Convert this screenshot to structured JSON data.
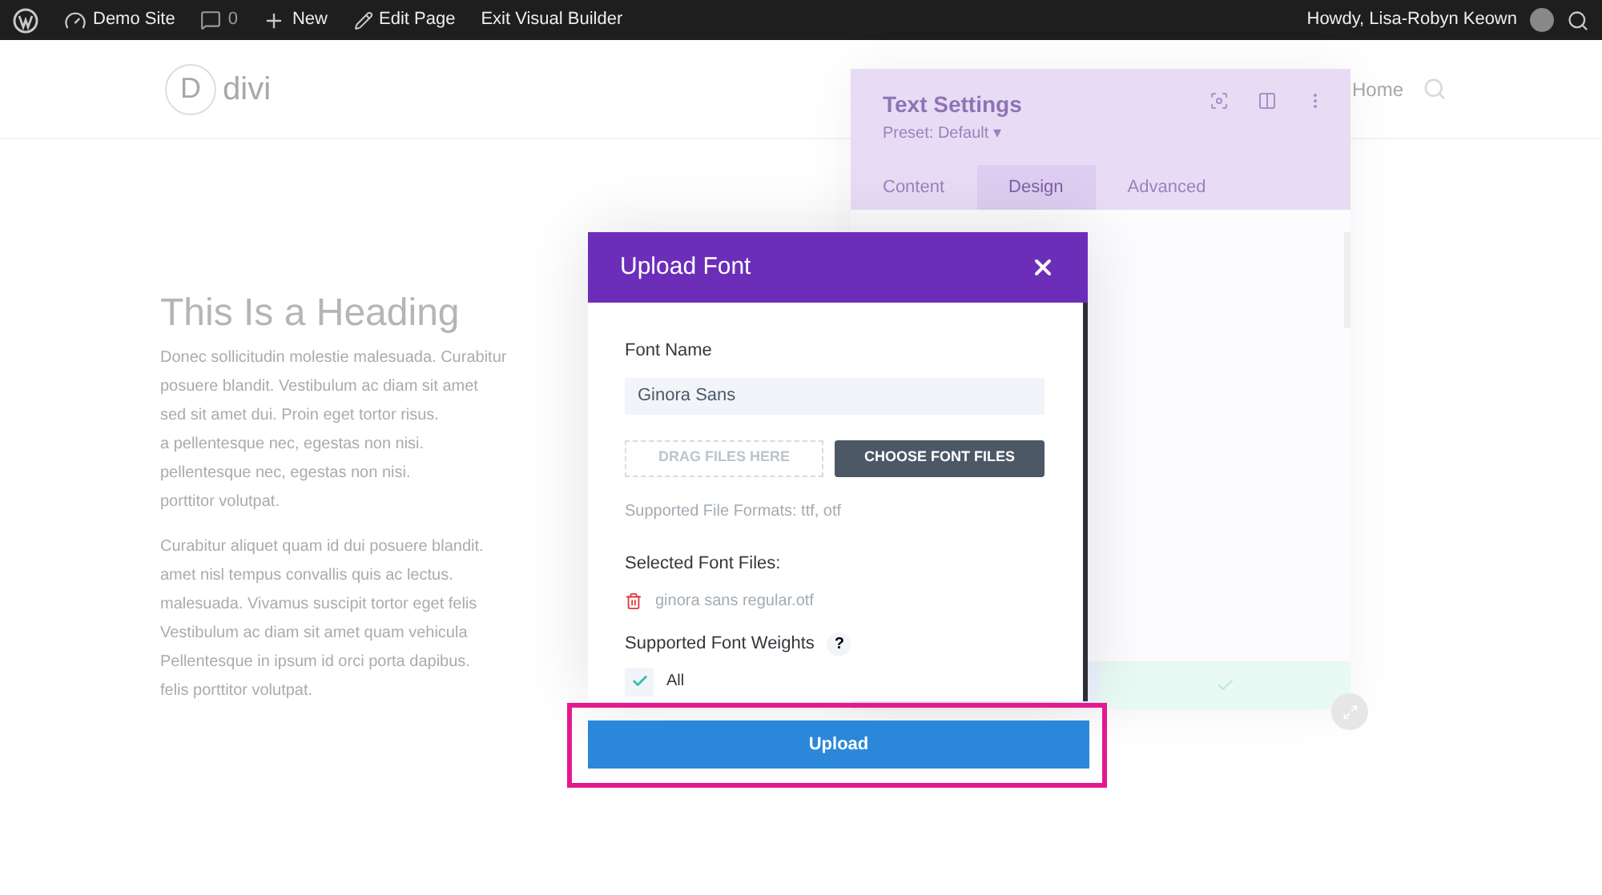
{
  "admin_bar": {
    "site": "Demo Site",
    "comments": "0",
    "new": "New",
    "edit": "Edit Page",
    "exit": "Exit Visual Builder",
    "greeting": "Howdy, Lisa-Robyn Keown"
  },
  "site_header": {
    "logo_letter": "D",
    "logo_text": "divi",
    "nav": "Home"
  },
  "page": {
    "heading": "This Is a Heading",
    "paragraphs": [
      [
        "Donec sollicitudin molestie malesuada. Curabitur",
        "posuere blandit. Vestibulum ac diam sit amet",
        "sed sit amet dui. Proin eget tortor risus.",
        "a pellentesque nec, egestas non nisi.",
        "pellentesque nec, egestas non nisi.",
        "porttitor volutpat."
      ],
      [
        "Curabitur aliquet quam id dui posuere blandit.",
        "amet nisl tempus convallis quis ac lectus.",
        "malesuada. Vivamus suscipit tortor eget felis",
        "Vestibulum ac diam sit amet quam vehicula",
        "Pellentesque in ipsum id orci porta dapibus.",
        "felis porttitor volutpat."
      ]
    ]
  },
  "settings_panel": {
    "title": "Text Settings",
    "preset": "Preset: Default ▾",
    "tabs": [
      {
        "label": "Content",
        "selected": false
      },
      {
        "label": "Design",
        "selected": true
      },
      {
        "label": "Advanced",
        "selected": false
      }
    ]
  },
  "modal": {
    "title": "Upload Font",
    "font_name_label": "Font Name",
    "font_name_value": "Ginora Sans",
    "drag_zone": "DRAG FILES HERE",
    "choose_button": "CHOOSE FONT FILES",
    "formats": "Supported File Formats: ttf, otf",
    "selected_label": "Selected Font Files:",
    "files": [
      "ginora sans regular.otf"
    ],
    "weights_label": "Supported Font Weights",
    "help": "?",
    "weights": [
      {
        "label": "All",
        "checked": true
      }
    ],
    "upload_button": "Upload",
    "highlighted": true
  }
}
